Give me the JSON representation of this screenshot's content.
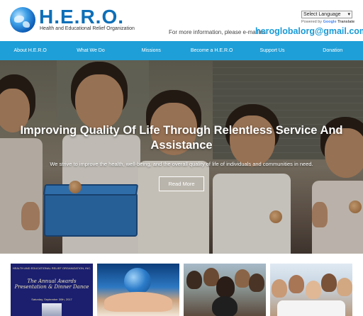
{
  "header": {
    "logo_title": "H.E.R.O.",
    "logo_subtitle": "Health and Educational Relief Organization",
    "language_select": "Select Language",
    "powered_by": "Powered by",
    "google": "Google",
    "translate": "Translate",
    "info_text": "For more information, please e-mail us",
    "email": "heroglobalorg@gmail.com"
  },
  "nav": {
    "items": [
      "About H.E.R.O",
      "What We Do",
      "Missions",
      "Become a H.E.R.O",
      "Support Us",
      "Donation"
    ]
  },
  "hero": {
    "title": "Improving Quality Of Life Through Relentless Service And Assistance",
    "text": "We strive to improve the health, well-being, and the overall quality of life of individuals and communities in need.",
    "button": "Read More"
  },
  "thumbnails": {
    "awards": {
      "org": "HEALTH AND EDUCATIONAL RELIEF ORGANIZATION, INC.",
      "title": "The Annual Awards Presentation & Dinner Dance",
      "date": "Saturday, September 30th, 2017"
    }
  },
  "colors": {
    "brand_blue": "#0d6fb8",
    "nav_blue": "#1e9fd8",
    "email_blue": "#1a9ad6"
  },
  "icons": {
    "logo": "globe-icon",
    "select_arrow": "chevron-down-icon"
  }
}
